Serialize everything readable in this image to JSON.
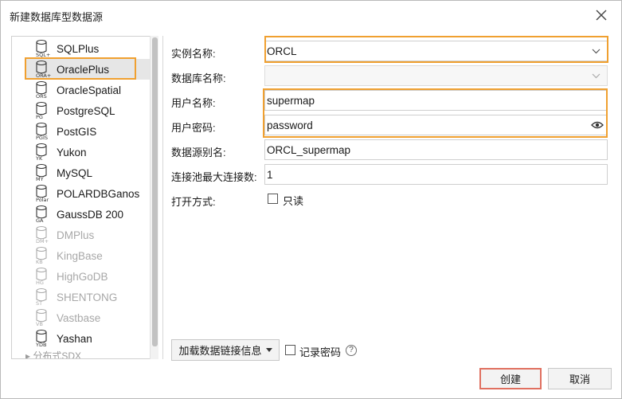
{
  "window": {
    "title": "新建数据库型数据源"
  },
  "tree": {
    "items": [
      {
        "label": "SQLPlus",
        "icon_tag": "SQL+",
        "enabled": true,
        "selected": false
      },
      {
        "label": "OraclePlus",
        "icon_tag": "ORA+",
        "enabled": true,
        "selected": true
      },
      {
        "label": "OracleSpatial",
        "icon_tag": "ORS",
        "enabled": true,
        "selected": false
      },
      {
        "label": "PostgreSQL",
        "icon_tag": "PG",
        "enabled": true,
        "selected": false
      },
      {
        "label": "PostGIS",
        "icon_tag": "PGIS",
        "enabled": true,
        "selected": false
      },
      {
        "label": "Yukon",
        "icon_tag": "YK",
        "enabled": true,
        "selected": false
      },
      {
        "label": "MySQL",
        "icon_tag": "MY",
        "enabled": true,
        "selected": false
      },
      {
        "label": "POLARDBGanos",
        "icon_tag": "Polar",
        "enabled": true,
        "selected": false
      },
      {
        "label": "GaussDB 200",
        "icon_tag": "GA",
        "enabled": true,
        "selected": false
      },
      {
        "label": "DMPlus",
        "icon_tag": "DM+",
        "enabled": false,
        "selected": false
      },
      {
        "label": "KingBase",
        "icon_tag": "KB",
        "enabled": false,
        "selected": false
      },
      {
        "label": "HighGoDB",
        "icon_tag": "HG",
        "enabled": false,
        "selected": false
      },
      {
        "label": "SHENTONG",
        "icon_tag": "ST",
        "enabled": false,
        "selected": false
      },
      {
        "label": "Vastbase",
        "icon_tag": "VB",
        "enabled": false,
        "selected": false
      },
      {
        "label": "Yashan",
        "icon_tag": "YDB",
        "enabled": true,
        "selected": false
      }
    ],
    "group_label": "▸ 分布式SDX"
  },
  "form": {
    "instance_label": "实例名称:",
    "instance_value": "ORCL",
    "database_label": "数据库名称:",
    "database_value": "",
    "username_label": "用户名称:",
    "username_value": "supermap",
    "password_label": "用户密码:",
    "password_value": "password",
    "alias_label": "数据源别名:",
    "alias_value": "ORCL_supermap",
    "pool_label": "连接池最大连接数:",
    "pool_value": "1",
    "open_mode_label": "打开方式:",
    "readonly_label": "只读",
    "readonly_checked": false
  },
  "footer": {
    "load_info_label": "加载数据链接信息",
    "remember_password_label": "记录密码",
    "remember_password_checked": false,
    "help_glyph": "?",
    "create_label": "创建",
    "cancel_label": "取消"
  },
  "colors": {
    "highlight": "#f0a030",
    "create_outline": "#e07060",
    "selected_bg": "#e6e6e6",
    "disabled_text": "#a8a8a8"
  }
}
